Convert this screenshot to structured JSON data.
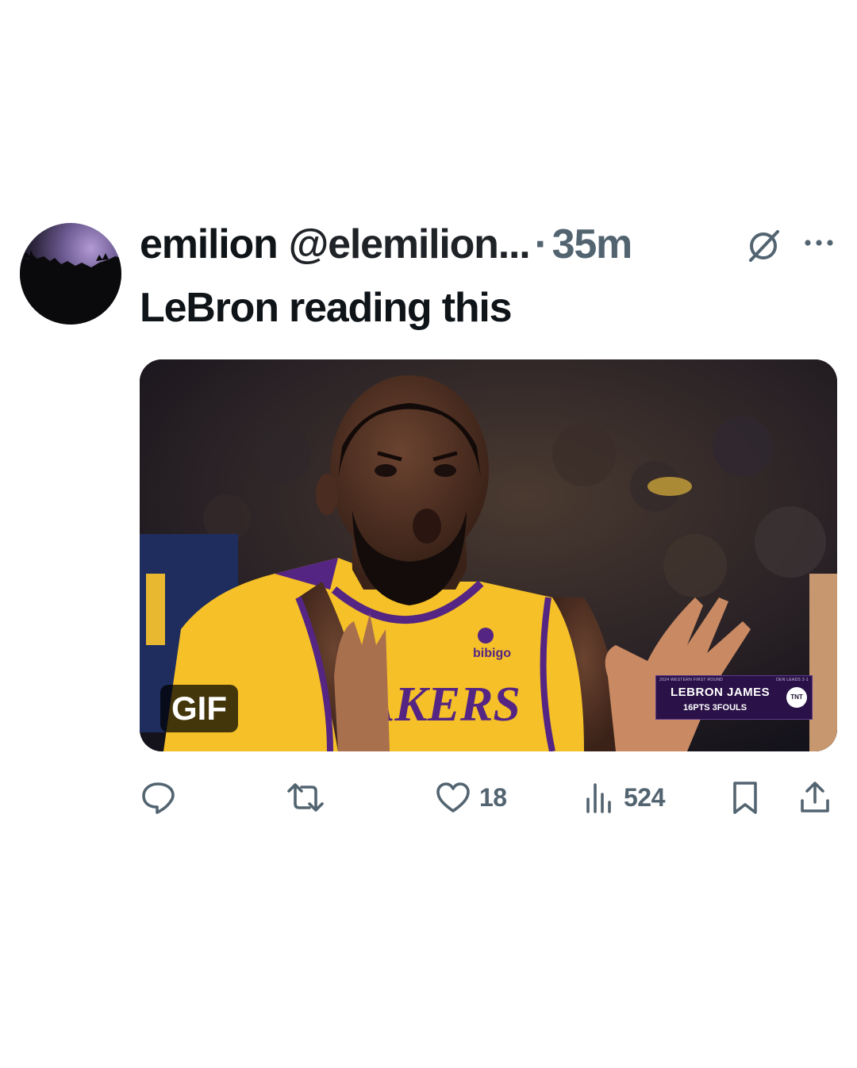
{
  "tweet": {
    "display_name": "emilion",
    "handle": "@elemilion...",
    "separator": "·",
    "time": "35m",
    "text": "LeBron reading this",
    "media": {
      "badge": "GIF",
      "jersey_text": "AKERS",
      "sponsor_text": "bibigo",
      "scorebug": {
        "header_left": "2024 WESTERN FIRST ROUND",
        "header_right": "DEN LEADS 2-1",
        "player": "LEBRON JAMES",
        "stats": "16PTS  3FOULS",
        "network": "TNT"
      }
    },
    "actions": {
      "reply_count": "",
      "retweet_count": "",
      "like_count": "18",
      "views_count": "524"
    }
  },
  "colors": {
    "text_primary": "#0f1419",
    "text_secondary": "#536471",
    "jersey_gold": "#f5c028",
    "jersey_purple": "#552583"
  },
  "icons": [
    "grok-icon",
    "more-icon",
    "reply-icon",
    "retweet-icon",
    "like-icon",
    "views-icon",
    "bookmark-icon",
    "share-icon"
  ]
}
